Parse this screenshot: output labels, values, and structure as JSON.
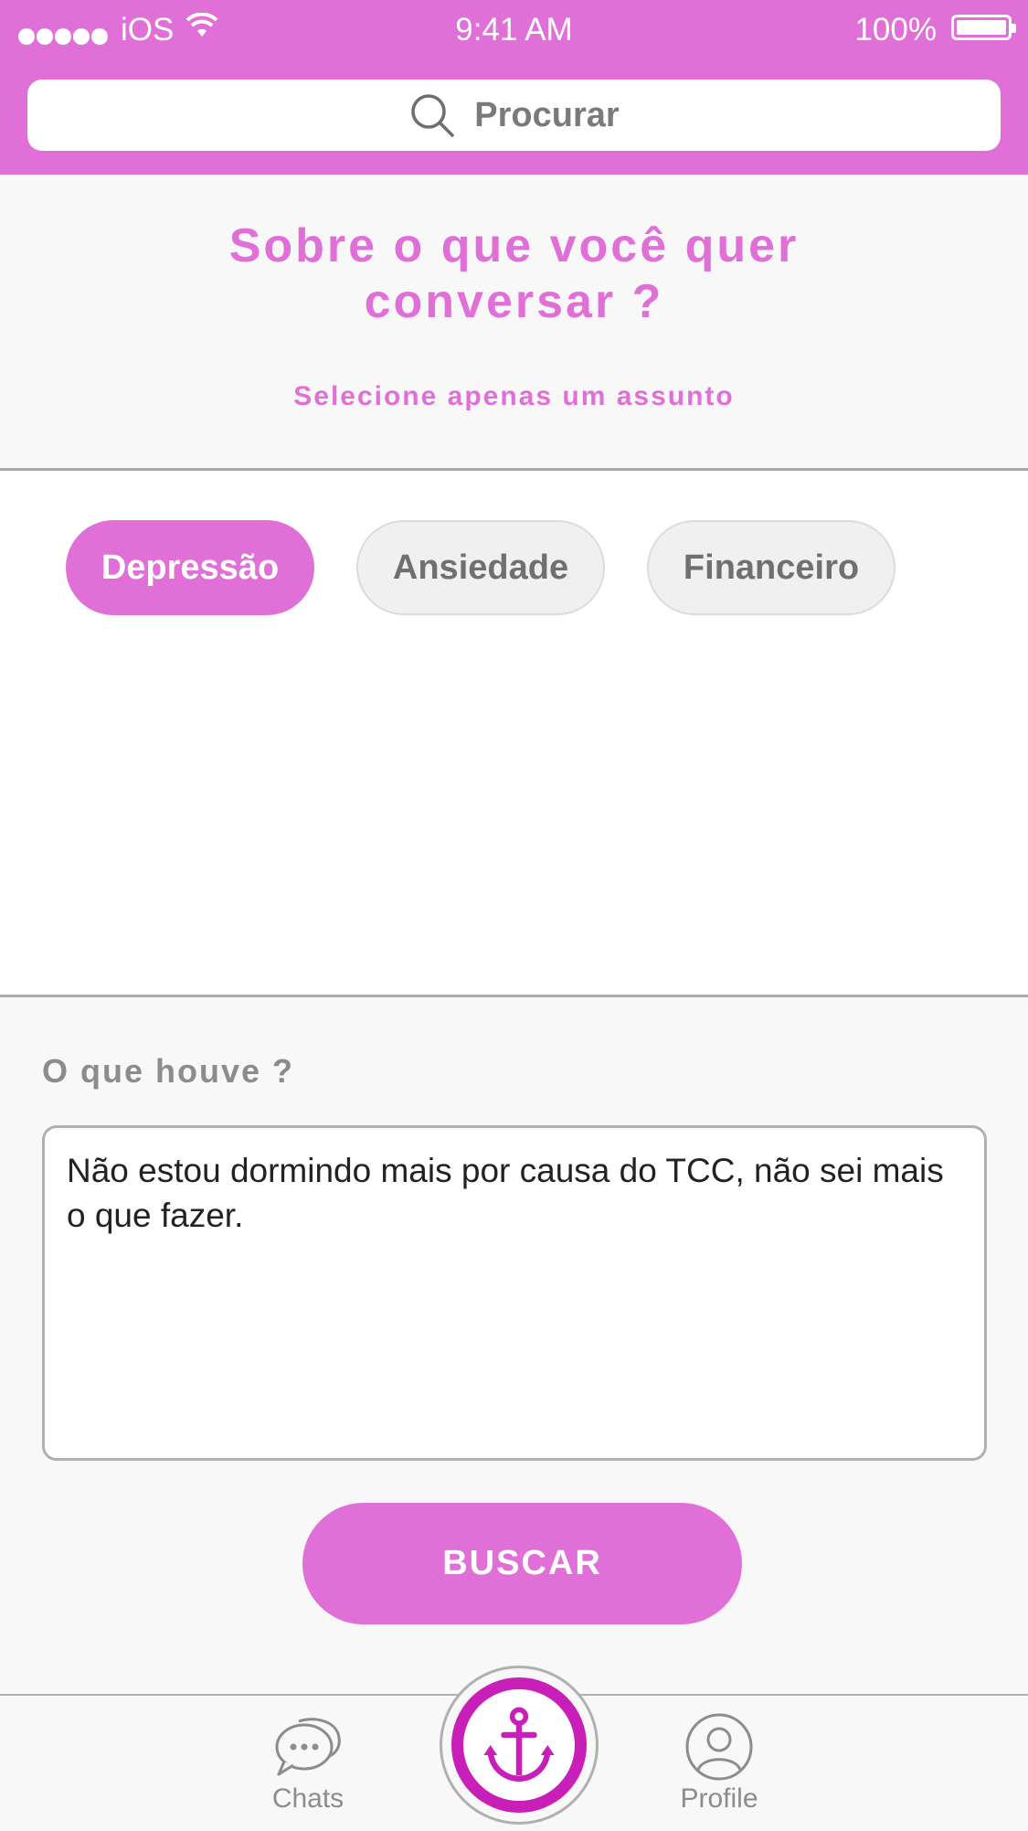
{
  "status_bar": {
    "carrier": "iOS",
    "time": "9:41 AM",
    "battery": "100%"
  },
  "search": {
    "placeholder": "Procurar"
  },
  "question": {
    "title": "Sobre o que você quer conversar ?",
    "subtitle": "Selecione apenas um assunto"
  },
  "topics": [
    {
      "label": "Depressão",
      "selected": true
    },
    {
      "label": "Ansiedade",
      "selected": false
    },
    {
      "label": "Financeiro",
      "selected": false
    }
  ],
  "details": {
    "label": "O que houve ?",
    "text": "Não estou dormindo mais por causa do TCC, não sei mais o que fazer."
  },
  "actions": {
    "search_button": "BUSCAR"
  },
  "tabbar": {
    "chats": "Chats",
    "profile": "Profile",
    "center_icon": "anchor-icon"
  },
  "colors": {
    "accent": "#e070d8",
    "accent_dark": "#c81fb8",
    "muted": "#8c8c8c"
  }
}
